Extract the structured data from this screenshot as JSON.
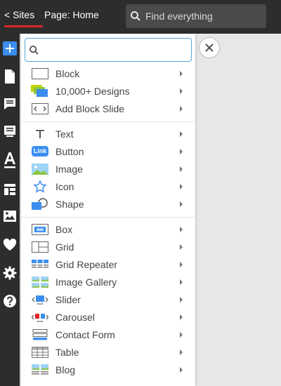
{
  "header": {
    "sites_link": "< Sites",
    "page_label": "Page: Home",
    "search_placeholder": "Find everything"
  },
  "sidebar": {
    "icons": [
      "add-icon",
      "page-icon",
      "comment-icon",
      "form-icon",
      "font-icon",
      "layout-icon",
      "image-icon",
      "heart-icon",
      "gear-icon",
      "help-icon"
    ]
  },
  "panel": {
    "search_value": "",
    "sections": [
      {
        "items": [
          {
            "label": "Block",
            "icon": "block-icon"
          },
          {
            "label": "10,000+ Designs",
            "icon": "designs-icon"
          },
          {
            "label": "Add Block Slide",
            "icon": "block-slide-icon"
          }
        ]
      },
      {
        "items": [
          {
            "label": "Text",
            "icon": "text-icon"
          },
          {
            "label": "Button",
            "icon": "link-button-icon",
            "icon_text": "Link"
          },
          {
            "label": "Image",
            "icon": "image-icon"
          },
          {
            "label": "Icon",
            "icon": "star-icon"
          },
          {
            "label": "Shape",
            "icon": "shape-icon"
          }
        ]
      },
      {
        "items": [
          {
            "label": "Box",
            "icon": "box-icon"
          },
          {
            "label": "Grid",
            "icon": "grid-icon"
          },
          {
            "label": "Grid Repeater",
            "icon": "grid-repeater-icon"
          },
          {
            "label": "Image Gallery",
            "icon": "image-gallery-icon"
          },
          {
            "label": "Slider",
            "icon": "slider-icon"
          },
          {
            "label": "Carousel",
            "icon": "carousel-icon"
          },
          {
            "label": "Contact Form",
            "icon": "contact-form-icon"
          },
          {
            "label": "Table",
            "icon": "table-icon"
          },
          {
            "label": "Blog",
            "icon": "blog-icon"
          }
        ]
      }
    ]
  },
  "colors": {
    "topbar_bg": "#2d2d2d",
    "accent_blue": "#3b8ef0",
    "sites_underline": "#e0262a",
    "search_border": "#55a6d9"
  }
}
